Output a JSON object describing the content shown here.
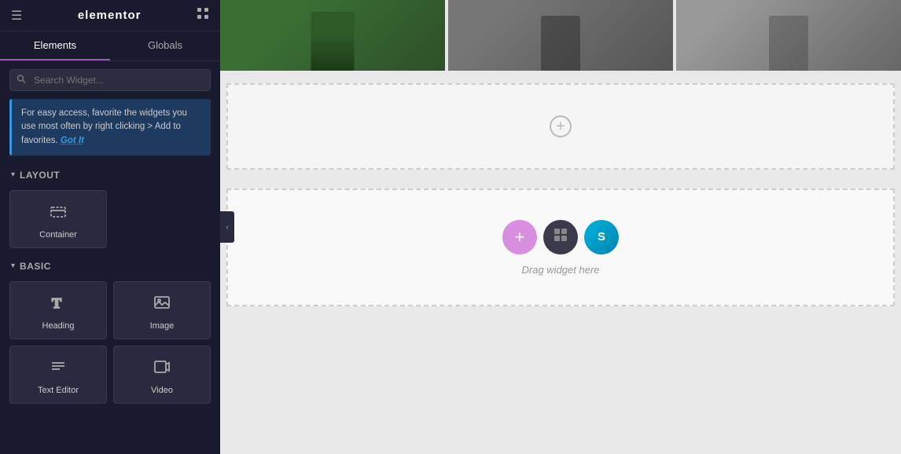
{
  "header": {
    "logo": "elementor",
    "hamburger_icon": "☰",
    "grid_icon": "⊞"
  },
  "tabs": {
    "elements_label": "Elements",
    "globals_label": "Globals"
  },
  "search": {
    "placeholder": "Search Widget..."
  },
  "tip": {
    "text": "For easy access, favorite the widgets you use most often by right clicking > Add to favorites.",
    "got_it": "Got It"
  },
  "layout_section": {
    "title": "Layout",
    "chevron": "▾"
  },
  "basic_section": {
    "title": "Basic",
    "chevron": "▾"
  },
  "widgets": {
    "container_label": "Container",
    "heading_label": "Heading",
    "image_label": "Image",
    "text_label": "Text Editor",
    "video_label": "Video"
  },
  "canvas": {
    "plus_label": "+",
    "drag_text": "Drag widget here"
  }
}
